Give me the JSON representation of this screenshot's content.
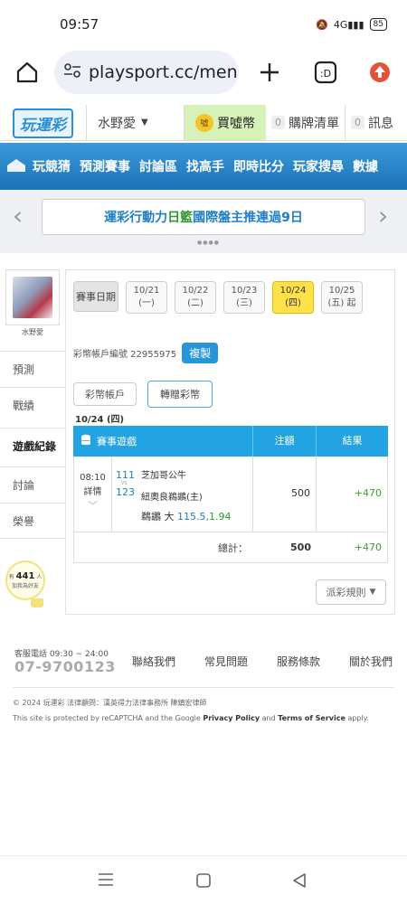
{
  "status_bar": {
    "time": "09:57",
    "signal_text": "4G",
    "battery": "85"
  },
  "browser": {
    "url": "playsport.cc/men"
  },
  "header": {
    "username": "水野愛",
    "buy_coins": "買噓幣",
    "coin_badge": "噓",
    "cart_count": "0",
    "cart_label": "購牌清單",
    "msg_count": "0",
    "msg_label": "訊息"
  },
  "nav": {
    "items": [
      "玩競猜",
      "預測賽事",
      "討論區",
      "找高手",
      "即時比分",
      "玩家搜尋",
      "數據"
    ]
  },
  "banner": {
    "text_a": "運彩行動力 ",
    "text_b": "日籃",
    "text_c": " 國際盤主推連過9日"
  },
  "sidebar": {
    "name": "水野愛",
    "items": [
      "預測",
      "戰績",
      "遊戲紀錄",
      "討論",
      "榮譽"
    ],
    "bulb_prefix": "有",
    "bulb_count": "441",
    "bulb_suffix": "人",
    "bulb_text": "加我為好友"
  },
  "dates": {
    "label": "賽事日期",
    "items": [
      {
        "date": "10/21",
        "day": "(一)"
      },
      {
        "date": "10/22",
        "day": "(二)"
      },
      {
        "date": "10/23",
        "day": "(三)"
      },
      {
        "date": "10/24",
        "day": "(四)"
      },
      {
        "date": "10/25",
        "day": "(五) 起"
      }
    ],
    "selected": 3
  },
  "account": {
    "label": "彩幣帳戶編號 22955975",
    "copy": "複製"
  },
  "tabs": [
    "彩幣帳戶",
    "轉贈彩幣"
  ],
  "date_title": "10/24 (四)",
  "table": {
    "headers": [
      "賽事遊戲",
      "注額",
      "結果"
    ],
    "rows": [
      {
        "time": "08:10",
        "detail": "詳情",
        "away_no": "111",
        "home_no": "123",
        "vs": "VS",
        "away_team": "芝加哥公牛",
        "home_team": "紐奧良鵜鶘(主)",
        "pick_team": "鵜鶘 大",
        "pick_line": "115.5",
        "pick_odds": "1.94",
        "bet": "500",
        "result": "+470"
      }
    ],
    "total_label": "總計：",
    "total_bet": "500",
    "total_result": "+470"
  },
  "rule_button": "派彩規則",
  "footer": {
    "phone_label": "客服電話 09:30 ~ 24:00",
    "phone": "07-9700123",
    "links": [
      "聯絡我們",
      "常見問題",
      "服務條款",
      "關於我們"
    ],
    "copyright": "© 2024 玩運彩 法律顧問：漢英得力法律事務所 陳鎮宏律師",
    "recaptcha_a": "This site is protected by reCAPTCHA and the Google ",
    "recaptcha_b": "Privacy Policy",
    "recaptcha_c": " and ",
    "recaptcha_d": "Terms of Service",
    "recaptcha_e": " apply."
  },
  "colors": {
    "nav_blue": "#1d72b8",
    "table_head": "#22a3e2",
    "selected_date": "#ffe24a",
    "win_green": "#3b9e2a"
  }
}
